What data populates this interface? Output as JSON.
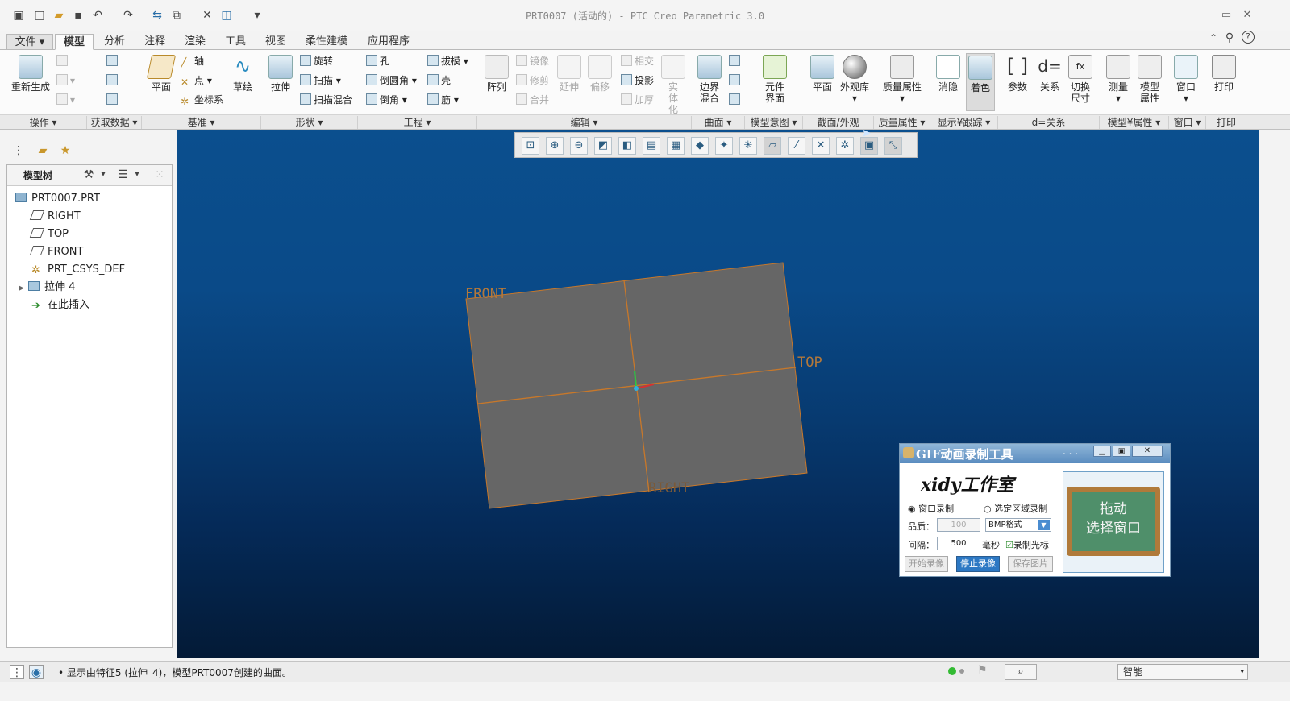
{
  "window": {
    "title": "PRT0007 (活动的) - PTC Creo Parametric 3.0"
  },
  "tabs": [
    {
      "label": "文件"
    },
    {
      "label": "模型"
    },
    {
      "label": "分析"
    },
    {
      "label": "注释"
    },
    {
      "label": "渲染"
    },
    {
      "label": "工具"
    },
    {
      "label": "视图"
    },
    {
      "label": "柔性建模"
    },
    {
      "label": "应用程序"
    }
  ],
  "ribbon": {
    "ops": {
      "regenerate": "重新生成"
    },
    "datum": {
      "plane": "平面",
      "axis": "轴",
      "point": "点",
      "csys": "坐标系",
      "sketch": "草绘"
    },
    "shapes": {
      "extrude": "拉伸",
      "revolve": "旋转",
      "sweep": "扫描",
      "swept_blend": "扫描混合"
    },
    "engineering": {
      "hole": "孔",
      "round": "倒圆角",
      "chamfer": "倒角",
      "draft": "拔模",
      "shell": "壳",
      "rib": "筋"
    },
    "editing": {
      "pattern": "阵列",
      "mirror": "镜像",
      "trim": "修剪",
      "merge": "合并",
      "extend": "延伸",
      "offset": "偏移",
      "intersect": "相交",
      "project": "投影",
      "thicken": "加厚",
      "solidify": "实体化"
    },
    "surfaces": {
      "boundary_blend": "边界混合"
    },
    "intent": {
      "component_interface": "元件界面"
    },
    "section": {
      "plane": "平面",
      "appearance": "外观库"
    },
    "mass": {
      "mass_props": "质量属性"
    },
    "display": {
      "hidden": "消隐",
      "shading": "着色"
    },
    "relations": {
      "params": "参数",
      "relations": "关系",
      "switch_dims": "切换尺寸"
    },
    "props": {
      "measure": "测量",
      "model_props": "模型属性"
    },
    "window": {
      "window": "窗口"
    },
    "print": {
      "print": "打印"
    },
    "groups": [
      "操作",
      "获取数据",
      "基准",
      "形状",
      "工程",
      "编辑",
      "曲面",
      "模型意图",
      "截面/外观",
      "质量属性",
      "显示¥跟踪",
      "d=关系",
      "模型¥属性",
      "窗口",
      "打印"
    ]
  },
  "left_panel": {
    "header": "模型树",
    "tree": [
      "PRT0007.PRT",
      "RIGHT",
      "TOP",
      "FRONT",
      "PRT_CSYS_DEF",
      "拉伸 4",
      "在此插入"
    ]
  },
  "viewport": {
    "plane_labels": {
      "front": "FRONT",
      "top": "TOP",
      "right": "RIGHT"
    }
  },
  "gif_tool": {
    "title": "GIF动画录制工具",
    "logo": "xidy工作室",
    "radio_window": "窗口录制",
    "radio_region": "选定区域录制",
    "quality_label": "品质：",
    "quality_value": "100",
    "format_value": "BMP格式",
    "interval_label": "间隔：",
    "interval_value": "500",
    "ms": "毫秒",
    "record_cursor": "录制光标",
    "btn_start": "开始录像",
    "btn_stop": "停止录像",
    "btn_save": "保存图片",
    "drag_line1": "拖动",
    "drag_line2": "选择窗口"
  },
  "statusbar": {
    "message": "• 显示由特征5 (拉伸_4)，模型PRT0007创建的曲面。",
    "filter": "智能"
  },
  "colors": {
    "accent": "#1a6fb3",
    "viewport_top": "#0b4f8e",
    "viewport_bottom": "#031a36",
    "plane_fill": "#666666",
    "datum": "#c8782a"
  }
}
